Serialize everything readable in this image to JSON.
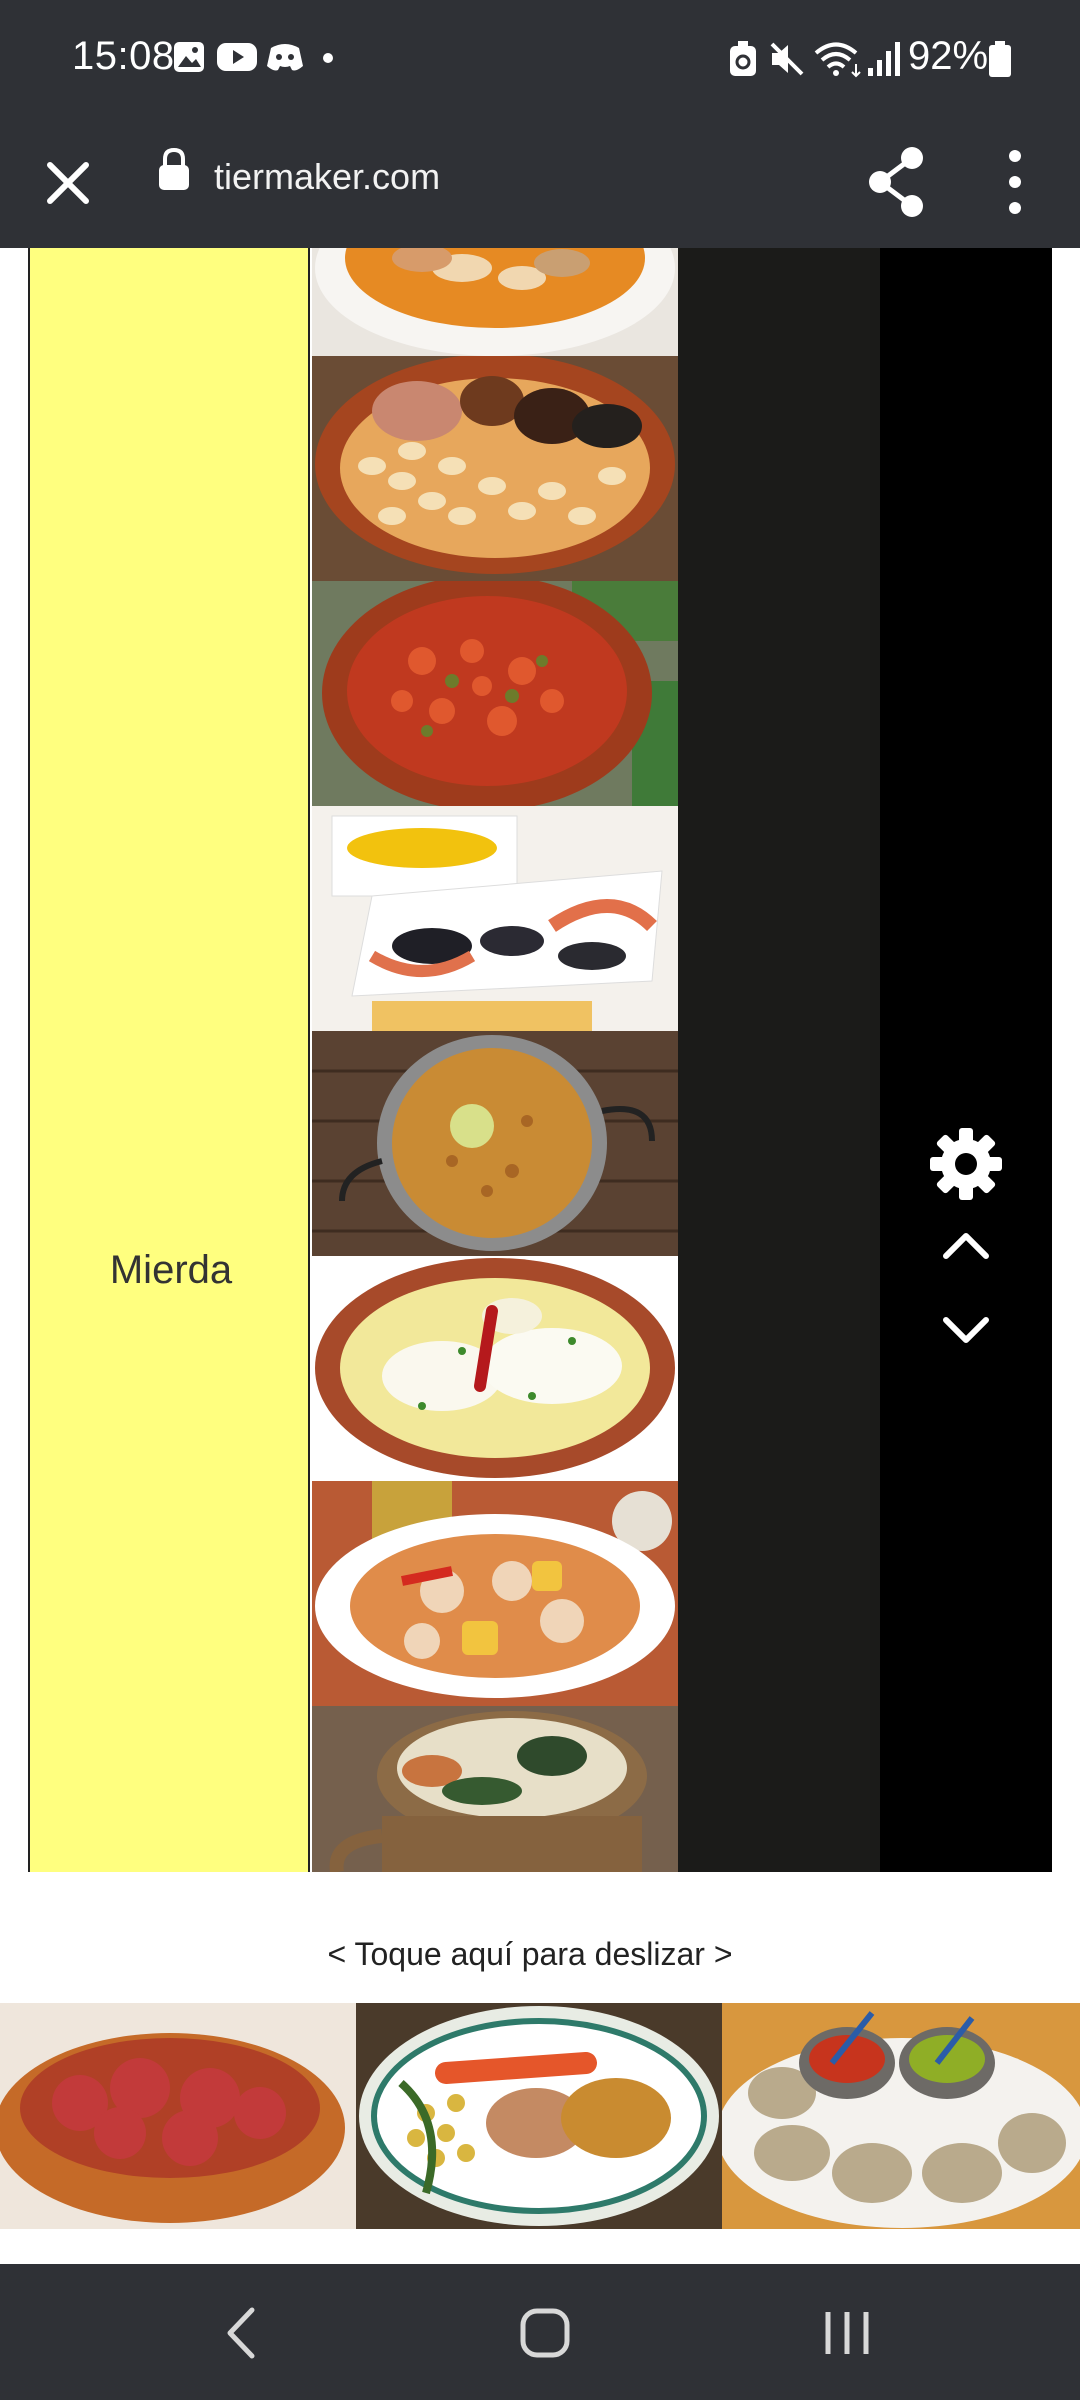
{
  "status_bar": {
    "time": "15:08",
    "battery_percent": "92%",
    "icons": [
      "gallery-icon",
      "youtube-icon",
      "discord-icon",
      "dot-icon",
      "battery-saver-icon",
      "mute-icon",
      "wifi-icon",
      "signal-icon",
      "battery-icon"
    ]
  },
  "browser": {
    "url": "tiermaker.com",
    "icons": [
      "close-icon",
      "lock-icon",
      "share-icon",
      "more-vert-icon"
    ]
  },
  "tier": {
    "label": "Mierda",
    "label_color": "#ffff7f",
    "items": [
      {
        "name": "fabada-plate-partial"
      },
      {
        "name": "fabada-asturiana"
      },
      {
        "name": "pisto"
      },
      {
        "name": "mariscada-con-arroz"
      },
      {
        "name": "arroz-a-banda"
      },
      {
        "name": "bacalao-al-pil-pil"
      },
      {
        "name": "guiso-de-pollo-con-patatas"
      },
      {
        "name": "potaje-de-alubias"
      }
    ],
    "controls": [
      "settings-gear-icon",
      "chevron-up-icon",
      "chevron-down-icon"
    ]
  },
  "slide_hint": "< Toque aquí para deslizar >",
  "tray": {
    "items": [
      {
        "name": "carne-en-salsa"
      },
      {
        "name": "cocido-madrileno"
      },
      {
        "name": "papas-arrugadas-con-mojo"
      }
    ]
  },
  "nav_bar": {
    "icons": [
      "back-icon",
      "home-icon",
      "recents-icon"
    ]
  }
}
